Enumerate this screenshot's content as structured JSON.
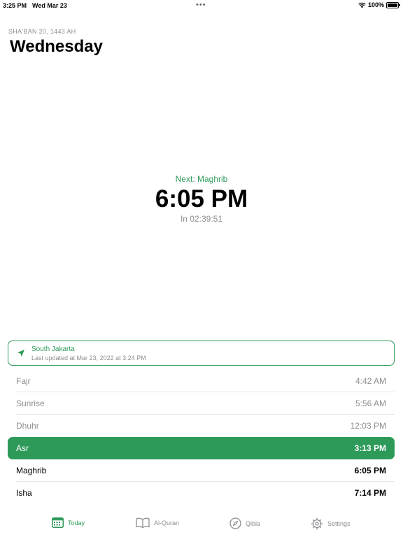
{
  "status_bar": {
    "time": "3:25 PM",
    "date": "Wed Mar 23",
    "dots": "•••",
    "battery": "100%"
  },
  "header": {
    "hijri_date": "SHA'BAN 20, 1443 AH",
    "day": "Wednesday"
  },
  "next_prayer": {
    "label": "Next: Maghrib",
    "time": "6:05 PM",
    "countdown": "In 02:39:51"
  },
  "location": {
    "name": "South Jakarta",
    "updated": "Last updated at Mar 23, 2022 at 3:24 PM"
  },
  "prayers": [
    {
      "name": "Fajr",
      "time": "4:42 AM",
      "state": "past"
    },
    {
      "name": "Sunrise",
      "time": "5:56 AM",
      "state": "past"
    },
    {
      "name": "Dhuhr",
      "time": "12:03 PM",
      "state": "past"
    },
    {
      "name": "Asr",
      "time": "3:13 PM",
      "state": "current"
    },
    {
      "name": "Maghrib",
      "time": "6:05 PM",
      "state": "future"
    },
    {
      "name": "Isha",
      "time": "7:14 PM",
      "state": "future"
    }
  ],
  "tabs": [
    {
      "label": "Today",
      "icon": "calendar-icon",
      "active": true
    },
    {
      "label": "Al-Quran",
      "icon": "book-icon",
      "active": false
    },
    {
      "label": "Qibla",
      "icon": "compass-icon",
      "active": false
    },
    {
      "label": "Settings",
      "icon": "gear-icon",
      "active": false
    }
  ],
  "colors": {
    "accent": "#2e9a5a",
    "secondary_text": "#8e8e93"
  }
}
